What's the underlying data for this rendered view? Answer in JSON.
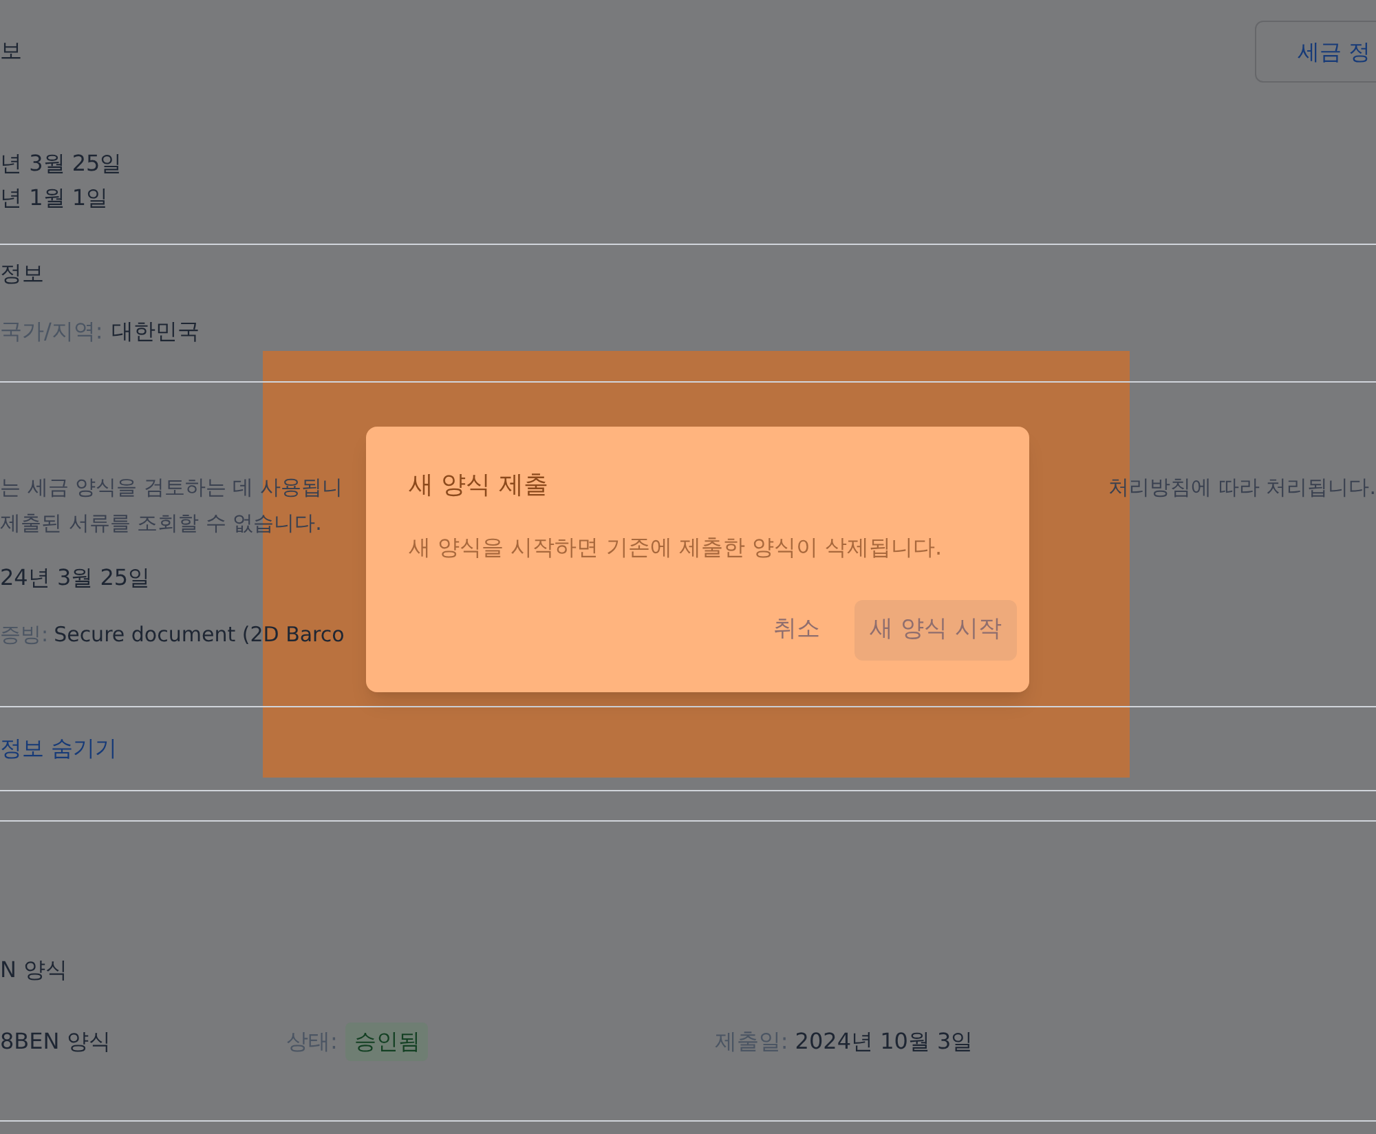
{
  "page": {
    "header": {
      "title": "보",
      "button": "세금 정"
    },
    "dates": [
      "년 3월 25일",
      "년 1월 1일"
    ],
    "residence": {
      "title": "정보",
      "label": "국가/지역:",
      "value": "대한민국"
    },
    "documents": {
      "notice_left": "는 세금 양식을 검토하는 데 사용됩니",
      "notice_right": "처리방침에 따라 처리됩니다.",
      "notice_line2": "제출된 서류를 조회할 수 없습니다.",
      "date": "24년 3월 25일",
      "proof_label": "증빙:",
      "proof_value": "Secure document (2D Barco"
    },
    "hide_link": "정보 숨기기",
    "forms": {
      "title": "N 양식",
      "row": {
        "name": "8BEN 양식",
        "status_label": "상태:",
        "status": "승인됨",
        "submitted_label": "제출일:",
        "submitted": "2024년 10월 3일"
      }
    }
  },
  "dialog": {
    "title": "새 양식 제출",
    "message": "새 양식을 시작하면 기존에 제출한 양식이 삭제됩니다.",
    "buttons": [
      {
        "label": "취소",
        "kind": "text"
      },
      {
        "label": "새 양식 시작",
        "kind": "filled"
      }
    ]
  }
}
